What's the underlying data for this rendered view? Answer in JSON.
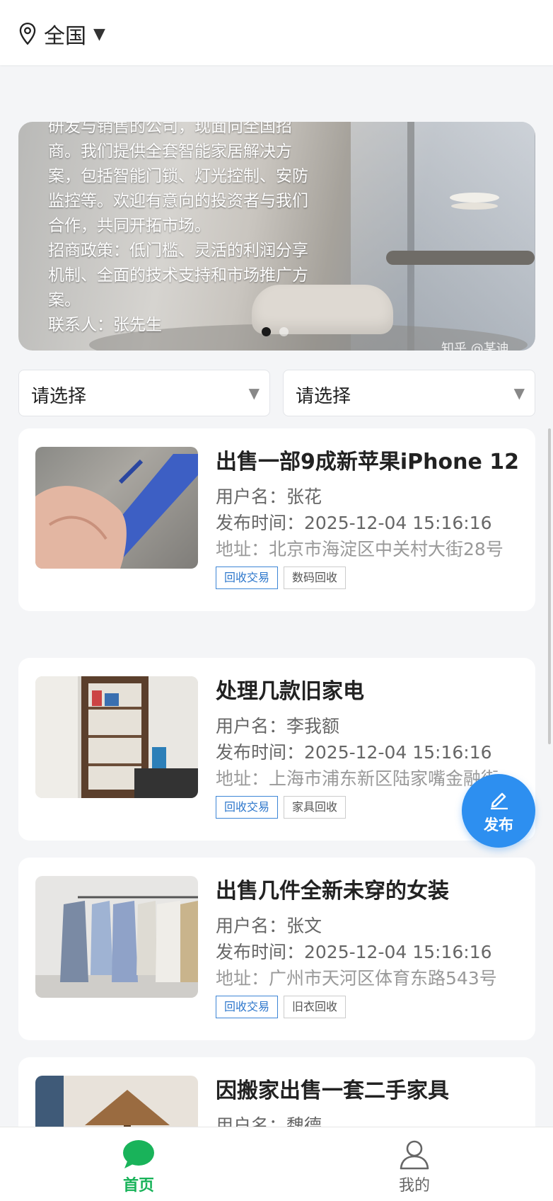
{
  "header": {
    "location_label": "全国"
  },
  "banner": {
    "text": "研发与销售的公司，现面向全国招商。我们提供全套智能家居解决方案，包括智能门锁、灯光控制、安防监控等。欢迎有意向的投资者与我们合作，共同开拓市场。\n招商政策：低门槛、灵活的利润分享机制、全面的技术支持和市场推广方案。\n联系人：张先生",
    "watermark": "知乎 @某迪",
    "slide_count": 2,
    "active_slide": 1
  },
  "filters": [
    {
      "placeholder": "请选择"
    },
    {
      "placeholder": "请选择"
    }
  ],
  "listings": [
    {
      "title": "出售一部9成新苹果iPhone 12",
      "user": "用户名：张花",
      "time": "发布时间：2025-12-04 15:16:16",
      "address": "地址：北京市海淀区中关村大街28号",
      "tags": [
        "回收交易",
        "数码回收"
      ]
    },
    {
      "title": "处理几款旧家电",
      "user": "用户名：李我额",
      "time": "发布时间：2025-12-04 15:16:16",
      "address": "地址：上海市浦东新区陆家嘴金融街",
      "tags": [
        "回收交易",
        "家具回收"
      ]
    },
    {
      "title": "出售几件全新未穿的女装",
      "user": "用户名：张文",
      "time": "发布时间：2025-12-04 15:16:16",
      "address": "地址：广州市天河区体育东路543号",
      "tags": [
        "回收交易",
        "旧衣回收"
      ]
    },
    {
      "title": "因搬家出售一套二手家具",
      "user": "用户名：魏德",
      "time": "",
      "address": "",
      "tags": []
    }
  ],
  "fab": {
    "label": "发布"
  },
  "tabbar": {
    "items": [
      {
        "label": "首页",
        "icon": "chat-bubble-icon",
        "active": true
      },
      {
        "label": "我的",
        "icon": "user-icon",
        "active": false
      }
    ]
  },
  "colors": {
    "accent_green": "#19b35a",
    "fab_blue": "#2d8ff0",
    "tag_blue": "#2f78cc"
  }
}
